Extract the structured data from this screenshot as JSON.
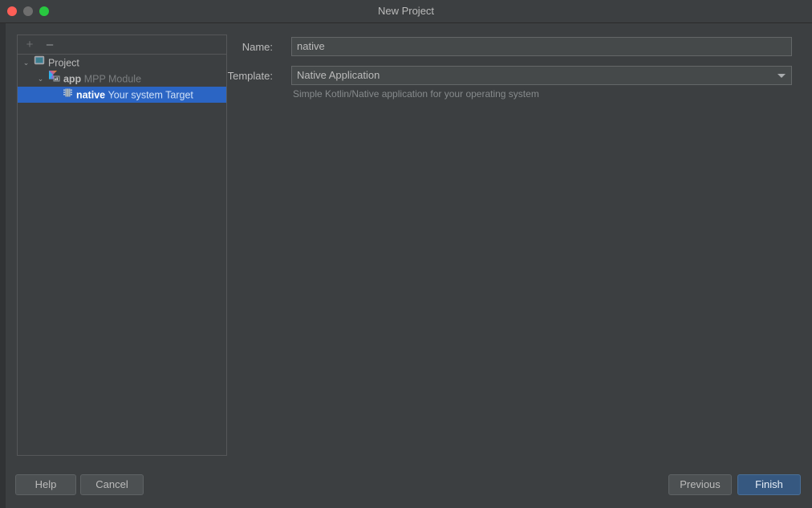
{
  "window": {
    "title": "New Project",
    "traffic_lights": [
      {
        "name": "close",
        "color": "#ff5f57"
      },
      {
        "name": "minimize",
        "color": "#6e6e6e"
      },
      {
        "name": "zoom",
        "color": "#28c840"
      }
    ]
  },
  "tree_panel": {
    "toolbar": {
      "add_label": "+",
      "remove_label": "–"
    },
    "rows": [
      {
        "label": "Project",
        "secondary": "",
        "icon": "project-module-icon",
        "twisty": "⌄",
        "indent": 0,
        "selected": false
      },
      {
        "label": "app",
        "secondary": "MPP Module",
        "icon": "kotlin-mpp-module-icon",
        "twisty": "⌄",
        "indent": 1,
        "selected": false
      },
      {
        "label": "native",
        "secondary": "Your system Target",
        "icon": "native-target-icon",
        "twisty": "",
        "indent": 2,
        "selected": true
      }
    ]
  },
  "form": {
    "name": {
      "label": "Name:",
      "value": "native",
      "placeholder": "Name"
    },
    "template": {
      "label": "Template:",
      "value": "Native Application",
      "hint": "Simple Kotlin/Native application for your operating system",
      "options": [
        "Native Application"
      ],
      "arrow_icon": "chevron-down-icon"
    }
  },
  "footer": {
    "help_label": "Help",
    "cancel_label": "Cancel",
    "previous_label": "Previous",
    "finish_label": "Finish"
  },
  "colors": {
    "window_bg": "#3c3f41",
    "panel_border": "#555759",
    "selection_blue": "#2b65c4",
    "primary_button": "#365880",
    "text": "#bbbbbb",
    "text_dim": "#7a7d7f"
  }
}
